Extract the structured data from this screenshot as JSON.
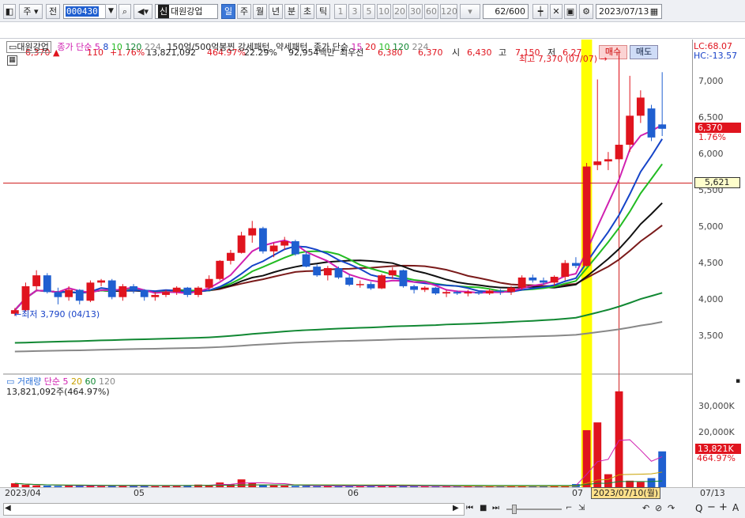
{
  "toolbar": {
    "mode_labels": [
      "주",
      "전"
    ],
    "code": "000430",
    "name_tag": "신",
    "name": "대원강업",
    "periods": [
      "일",
      "주",
      "월",
      "년",
      "분",
      "초",
      "틱"
    ],
    "active_period": "일",
    "intervals": [
      "1",
      "3",
      "5",
      "10",
      "20",
      "30",
      "60",
      "120"
    ],
    "count": "62",
    "count_total": "/600",
    "date": "2023/07/13"
  },
  "quote": {
    "price": "6,370",
    "arrow": "▲",
    "change": "110",
    "change_pct": "+1.76%",
    "volume": "13,821,092",
    "volume_ratio": "464.97%",
    "turnover": "22.29%",
    "amount": "92,954백만",
    "best_label": "최우선",
    "best_ask": "6,380",
    "best_bid": "6,370",
    "open_label": "시",
    "open": "6,430",
    "high_label": "고",
    "high": "7,150",
    "low_label": "저",
    "low": "6,270",
    "buy_label": "매수",
    "sell_label": "매도"
  },
  "legend": {
    "stock": "대원강업",
    "ma_title": "종가 단순",
    "ma_periods": [
      "5",
      "8",
      "10",
      "120",
      "224"
    ],
    "ma_colors": [
      "#d020b0",
      "#1544c8",
      "#22bb22",
      "#118833",
      "#888888"
    ],
    "pattern1": "150억/500억봉찐 강세패턴",
    "pattern2": "약세패턴",
    "ma2_title": "종가 단순",
    "ma2_periods": [
      "15",
      "20",
      "10",
      "120",
      "224"
    ],
    "ma2_colors": [
      "#d020b0",
      "#e0141e",
      "#22bb22",
      "#118833",
      "#888888"
    ],
    "vol_title": "거래량",
    "vol_ma_title": "단순",
    "vol_ma_periods": [
      "5",
      "20",
      "60",
      "120"
    ],
    "vol_ma_colors": [
      "#d020b0",
      "#c8a000",
      "#118833",
      "#888888"
    ],
    "vol_value": "13,821,092주(464.97%)"
  },
  "annotations": {
    "high": "최고 7,370 (07/07)",
    "low": "최저 3,790 (04/13)",
    "lc": "LC:68.07",
    "hc": "HC:-13.57",
    "cur_price": "6,370",
    "cur_pct": "1.76%",
    "ref_price": "5,621",
    "cur_vol": "13,821K",
    "cur_vol_pct": "464.97%"
  },
  "price_ticks": [
    "7,000",
    "6,500",
    "6,000",
    "5,500",
    "5,000",
    "4,500",
    "4,000",
    "3,500"
  ],
  "volume_ticks": [
    "30,000K",
    "20,000K",
    "10,000K"
  ],
  "date_labels": [
    "2023/04",
    "05",
    "06",
    "07",
    "07/13"
  ],
  "cursor_date": "2023/07/10(월)",
  "colors": {
    "up": "#e0141e",
    "down": "#1f5fd0",
    "highlight": "#ffff00"
  },
  "chart_data": {
    "type": "candlestick",
    "ylim": [
      3000,
      7600
    ],
    "volume_ylim": [
      0,
      40000
    ],
    "candles": [
      [
        3820,
        3900,
        3790,
        3870
      ],
      [
        3870,
        4250,
        3850,
        4200
      ],
      [
        4200,
        4420,
        4150,
        4350
      ],
      [
        4350,
        4380,
        4100,
        4120
      ],
      [
        4120,
        4180,
        3950,
        4050
      ],
      [
        4050,
        4200,
        4000,
        4150
      ],
      [
        4150,
        4160,
        3950,
        4000
      ],
      [
        4000,
        4280,
        3980,
        4250
      ],
      [
        4250,
        4300,
        4200,
        4280
      ],
      [
        4280,
        4300,
        4020,
        4050
      ],
      [
        4050,
        4230,
        4000,
        4200
      ],
      [
        4200,
        4230,
        4100,
        4150
      ],
      [
        4150,
        4160,
        4000,
        4050
      ],
      [
        4050,
        4120,
        4000,
        4080
      ],
      [
        4080,
        4150,
        4050,
        4120
      ],
      [
        4120,
        4200,
        4080,
        4180
      ],
      [
        4180,
        4190,
        4050,
        4080
      ],
      [
        4080,
        4200,
        4050,
        4180
      ],
      [
        4180,
        4350,
        4150,
        4300
      ],
      [
        4300,
        4560,
        4280,
        4550
      ],
      [
        4550,
        4700,
        4500,
        4660
      ],
      [
        4660,
        4950,
        4650,
        4900
      ],
      [
        4900,
        5100,
        4800,
        5000
      ],
      [
        5000,
        5020,
        4650,
        4680
      ],
      [
        4680,
        4800,
        4600,
        4760
      ],
      [
        4760,
        4880,
        4700,
        4820
      ],
      [
        4820,
        4840,
        4620,
        4640
      ],
      [
        4640,
        4680,
        4460,
        4470
      ],
      [
        4470,
        4500,
        4330,
        4350
      ],
      [
        4350,
        4480,
        4280,
        4450
      ],
      [
        4450,
        4470,
        4300,
        4320
      ],
      [
        4320,
        4360,
        4200,
        4220
      ],
      [
        4220,
        4280,
        4180,
        4230
      ],
      [
        4230,
        4260,
        4150,
        4170
      ],
      [
        4170,
        4370,
        4160,
        4350
      ],
      [
        4350,
        4460,
        4300,
        4420
      ],
      [
        4420,
        4430,
        4180,
        4200
      ],
      [
        4200,
        4220,
        4100,
        4150
      ],
      [
        4150,
        4200,
        4120,
        4180
      ],
      [
        4180,
        4190,
        4080,
        4100
      ],
      [
        4100,
        4150,
        4050,
        4120
      ],
      [
        4120,
        4140,
        4080,
        4100
      ],
      [
        4100,
        4150,
        4060,
        4120
      ],
      [
        4120,
        4140,
        4080,
        4100
      ],
      [
        4100,
        4160,
        4080,
        4140
      ],
      [
        4140,
        4160,
        4080,
        4120
      ],
      [
        4120,
        4200,
        4080,
        4180
      ],
      [
        4180,
        4350,
        4150,
        4320
      ],
      [
        4320,
        4360,
        4250,
        4280
      ],
      [
        4280,
        4320,
        4220,
        4250
      ],
      [
        4250,
        4350,
        4200,
        4330
      ],
      [
        4330,
        4560,
        4280,
        4520
      ],
      [
        4520,
        4600,
        4450,
        4480
      ],
      [
        4480,
        5900,
        4470,
        5850
      ],
      [
        5870,
        7050,
        5800,
        5920
      ],
      [
        5920,
        6050,
        5800,
        5950
      ],
      [
        5950,
        7370,
        5900,
        6150
      ],
      [
        6150,
        7100,
        6050,
        6550
      ],
      [
        6550,
        6900,
        6450,
        6800
      ],
      [
        6650,
        6700,
        6200,
        6250
      ],
      [
        6430,
        7150,
        6270,
        6370
      ]
    ],
    "volumes": [
      1500,
      900,
      700,
      600,
      500,
      600,
      700,
      500,
      400,
      600,
      500,
      700,
      500,
      400,
      500,
      600,
      800,
      1000,
      900,
      1800,
      1100,
      3000,
      1600,
      900,
      700,
      600,
      500,
      500,
      400,
      500,
      400,
      400,
      400,
      500,
      500,
      400,
      400,
      300,
      400,
      300,
      300,
      300,
      300,
      300,
      300,
      400,
      500,
      400,
      400,
      400,
      500,
      600,
      1200,
      22000,
      25000,
      5000,
      37000,
      2500,
      2000,
      3500,
      13821
    ]
  }
}
